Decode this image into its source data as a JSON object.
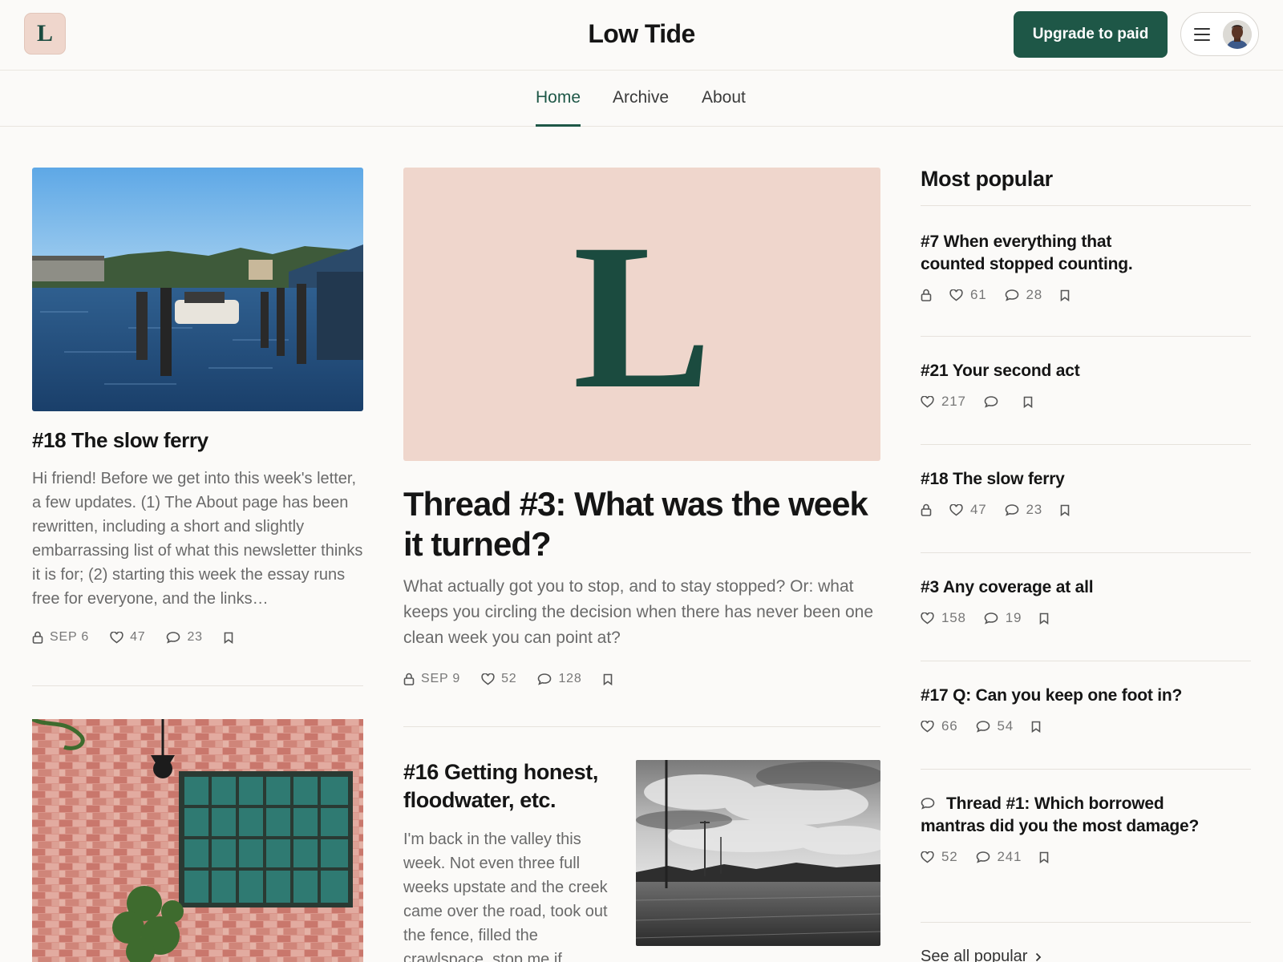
{
  "header": {
    "logo_letter": "L",
    "site_title": "Low Tide",
    "upgrade_label": "Upgrade to paid"
  },
  "nav": {
    "tabs": [
      {
        "label": "Home",
        "active": true
      },
      {
        "label": "Archive",
        "active": false
      },
      {
        "label": "About",
        "active": false
      }
    ]
  },
  "left_posts": [
    {
      "title": "#18 The slow ferry",
      "excerpt": "Hi friend! Before we get into this week's letter, a few updates. (1) The About page has been rewritten, including a short and slightly embarrassing list of what this newsletter thinks it is for; (2) starting this week the essay runs free for everyone, and the links…",
      "date": "SEP 6",
      "likes": "47",
      "comments": "23",
      "locked": true
    }
  ],
  "featured": {
    "logo_letter": "L",
    "title": "Thread #3: What was the week it turned?",
    "excerpt": "What actually got you to stop, and to stay stopped? Or: what keeps you circling the decision when there has never been one clean week you can point at?",
    "date": "SEP 9",
    "likes": "52",
    "comments": "128",
    "locked": true
  },
  "post16": {
    "title": "#16 Getting honest, floodwater, etc.",
    "excerpt": "I'm back in the valley this week. Not even three full weeks upstate and the creek came over the road, took out the fence, filled the crawlspace, stop me if"
  },
  "sidebar": {
    "heading": "Most popular",
    "items": [
      {
        "title": "#7 When everything that counted stopped counting.",
        "likes": "61",
        "comments": "28",
        "locked": true
      },
      {
        "title": "#21 Your second act",
        "likes": "217",
        "comments": "",
        "locked": false
      },
      {
        "title": "#18 The slow ferry",
        "likes": "47",
        "comments": "23",
        "locked": true
      },
      {
        "title": "#3 Any coverage at all",
        "likes": "158",
        "comments": "19",
        "locked": false
      },
      {
        "title": "#17 Q: Can you keep one foot in?",
        "likes": "66",
        "comments": "54",
        "locked": false
      },
      {
        "title": "Thread #1: Which borrowed mantras did you the most damage?",
        "likes": "52",
        "comments": "241",
        "locked": false
      }
    ],
    "see_all": "See all popular"
  },
  "colors": {
    "accent": "#1e5747",
    "logo_bg": "#efd6cc"
  }
}
